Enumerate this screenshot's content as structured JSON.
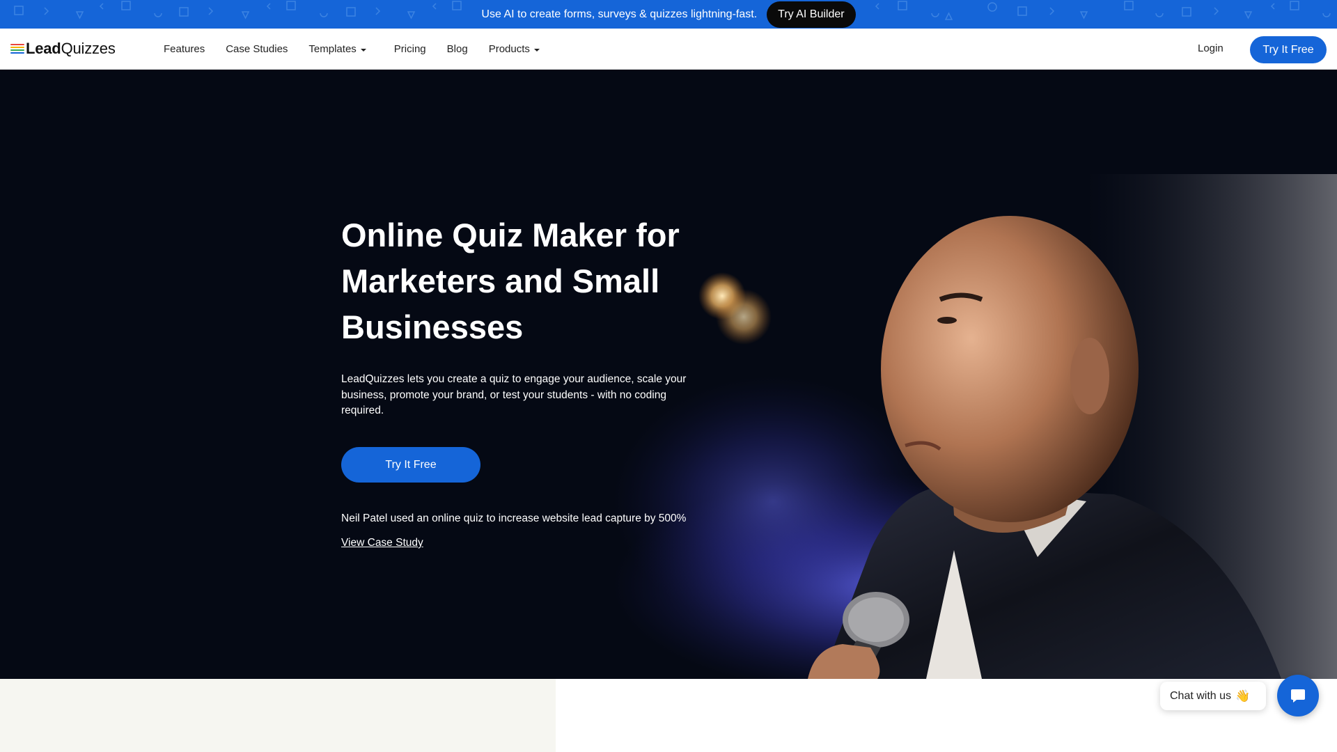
{
  "announcement": {
    "message": "Use AI to create forms, surveys & quizzes lightning-fast.",
    "button_label": "Try AI Builder",
    "background": "#1565d8"
  },
  "nav": {
    "logo": {
      "bold": "Lead",
      "regular": "Quizzes",
      "stripe_colors": [
        "#e8453c",
        "#f5b400",
        "#34a853",
        "#1565d8"
      ]
    },
    "items": [
      {
        "label": "Features",
        "has_caret": false
      },
      {
        "label": "Case Studies",
        "has_caret": false
      },
      {
        "label": "Templates",
        "has_caret": true
      },
      {
        "label": "Pricing",
        "has_caret": false
      },
      {
        "label": "Blog",
        "has_caret": false
      },
      {
        "label": "Products",
        "has_caret": true
      }
    ],
    "login_label": "Login",
    "cta_label": "Try It Free"
  },
  "hero": {
    "title": "Online Quiz Maker for Marketers and Small Businesses",
    "description": "LeadQuizzes lets you create a quiz to engage your audience, scale your business, promote your brand, or test your students - with no coding required.",
    "cta_label": "Try It Free",
    "social_proof": "Neil Patel used an online quiz to increase website lead capture by 500%",
    "case_study_link": "View Case Study",
    "background": "#050914"
  },
  "chat": {
    "label": "Chat with us",
    "emoji": "👋"
  },
  "colors": {
    "accent": "#1565d8",
    "dark": "#0a0a0a",
    "cream": "#f6f6f1"
  }
}
